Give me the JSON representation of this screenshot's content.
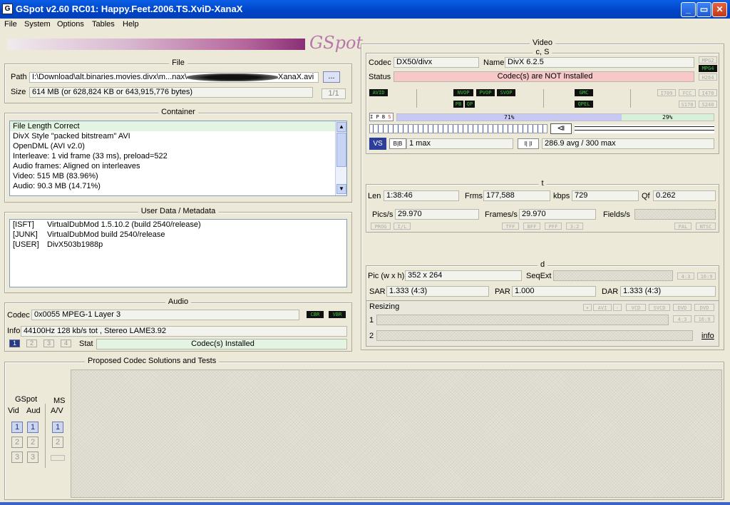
{
  "window": {
    "title": "GSpot v2.60 RC01: Happy.Feet.2006.TS.XviD-XanaX"
  },
  "menu": [
    "File",
    "System",
    "Options",
    "Tables",
    "Help"
  ],
  "logo": "GSpot",
  "file": {
    "group_title": "File",
    "path_label": "Path",
    "path_value": "I:\\Download\\alt.binaries.movies.divx\\m...nax\\",
    "path_suffix": "XanaX.avi",
    "browse_label": "...",
    "size_label": "Size",
    "size_value": "614 MB (or 628,824 KB or 643,915,776 bytes)",
    "page_indicator": "1/1"
  },
  "container": {
    "group_title": "Container",
    "lines": [
      "File Length Correct",
      "DivX Style \"packed bitstream\" AVI",
      "OpenDML (AVI v2.0)",
      "Interleave: 1 vid frame (33 ms), preload=522",
      "Audio frames: Aligned on interleaves",
      "Video: 515 MB (83.96%)",
      "Audio: 90.3 MB (14.71%)"
    ]
  },
  "metadata": {
    "group_title": "User Data / Metadata",
    "rows": [
      {
        "tag": "[ISFT]",
        "value": "VirtualDubMod 1.5.10.2 (build 2540/release)"
      },
      {
        "tag": "[JUNK]",
        "value": "VirtualDubMod build 2540/release"
      },
      {
        "tag": "[USER]",
        "value": "DivX503b1988p"
      }
    ]
  },
  "audio": {
    "group_title": "Audio",
    "codec_label": "Codec",
    "codec_value": "0x0055 MPEG-1 Layer 3",
    "cbr": "CBR",
    "vbr": "VBR",
    "info_label": "Info",
    "info_value": "44100Hz  128 kb/s tot , Stereo LAME3.92",
    "streams": [
      "1",
      "2",
      "3",
      "4"
    ],
    "stat_label": "Stat",
    "stat_value": "Codec(s) Installed"
  },
  "video": {
    "group_title": "Video",
    "cs_title": "c, S",
    "codec_label": "Codec",
    "codec_value": "DX50/divx",
    "name_label": "Name",
    "name_value": "DivX 6.2.5",
    "status_label": "Status",
    "status_value": "Codec(s) are NOT Installed",
    "side_chips": [
      "MPG2",
      "MPG4",
      "H264"
    ],
    "flags": [
      "AVID",
      "NVOP",
      "PVOP",
      "SVOP",
      "PB",
      "QP",
      "GMC",
      "QPEL",
      "I709",
      "FCC",
      "I470",
      "S170",
      "S240"
    ],
    "frame_types": [
      "I",
      "P",
      "B",
      "S"
    ],
    "bar_left_pct": "71%",
    "bar_right_pct": "29%",
    "bframes_label": "1 max",
    "bitrate_label": "286.9 avg / 300 max",
    "bar_fraction": 0.71,
    "t_title": "t",
    "len_label": "Len",
    "len_value": "1:38:46",
    "frms_label": "Frms",
    "frms_value": "177,588",
    "kbps_label": "kbps",
    "kbps_value": "729",
    "qf_label": "Qf",
    "qf_value": "0.262",
    "pics_label": "Pics/s",
    "pics_value": "29.970",
    "frames_label": "Frames/s",
    "frames_value": "29.970",
    "fields_label": "Fields/s",
    "t_chips": [
      "PROG",
      "I/L",
      "TFF",
      "BFF",
      "PFF",
      "3:2",
      "PAL",
      "NTSC"
    ],
    "d_title": "d",
    "pic_label": "Pic (w x h)",
    "pic_value": "352 x 264",
    "seqext_label": "SeqExt",
    "ratio_chips": [
      "4:3",
      "16:9"
    ],
    "sar_label": "SAR",
    "sar_value": "1.333 (4:3)",
    "par_label": "PAR",
    "par_value": "1.000",
    "dar_label": "DAR",
    "dar_value": "1.333 (4:3)",
    "resizing_label": "Resizing",
    "resize_chips": [
      "+",
      "AVI",
      "-",
      "VCD",
      "SVCD",
      "DVD",
      "DVD"
    ],
    "resize_ratio_chips": [
      "4:3",
      "16:9"
    ],
    "row1_label": "1",
    "row2_label": "2",
    "info_link": "info"
  },
  "proposed": {
    "group_title": "Proposed Codec Solutions and Tests",
    "gspot_label": "GSpot",
    "ms_label": "MS",
    "vid_label": "Vid",
    "aud_label": "Aud",
    "av_label": "A/V",
    "buttons": [
      "1",
      "2",
      "3"
    ]
  }
}
